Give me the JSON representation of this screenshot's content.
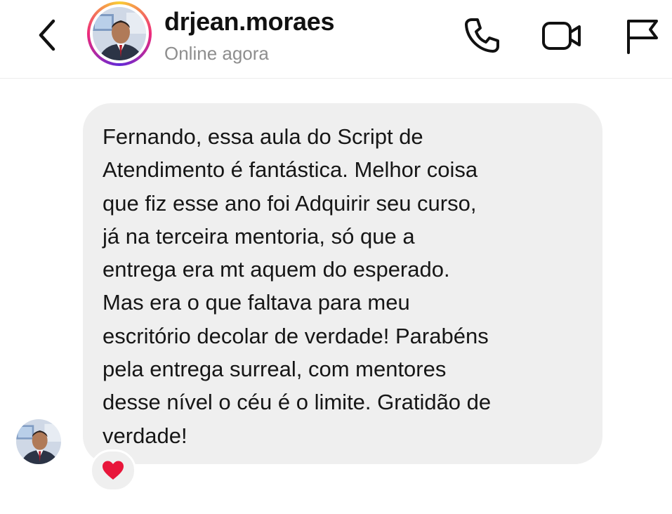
{
  "header": {
    "username": "drjean.moraes",
    "status": "Online agora",
    "icons": [
      "back-icon",
      "phone-icon",
      "video-call-icon",
      "flag-icon"
    ]
  },
  "message": {
    "text": "Fernando, essa aula do Script  de\nAtendimento é fantástica. Melhor coisa\nque fiz esse ano foi Adquirir seu curso,\njá na terceira mentoria, só que a\nentrega era mt aquem do esperado.\nMas era o que faltava para meu\nescritório decolar de verdade! Parabéns\npela entrega surreal, com mentores\ndesse nível o céu é o limite. Gratidão de\nverdade!",
    "reaction": "heart-icon"
  },
  "colors": {
    "bubble": "#efefef",
    "status_text": "#8e8e8e",
    "heart": "#e8163a"
  }
}
